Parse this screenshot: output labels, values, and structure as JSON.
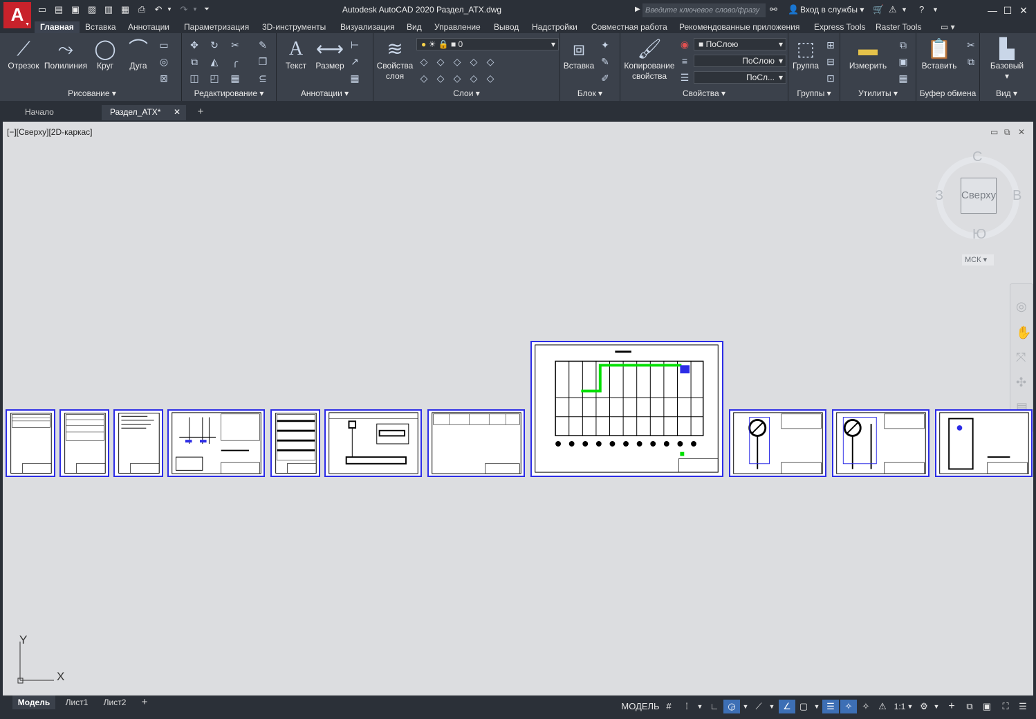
{
  "window": {
    "title": "Autodesk AutoCAD 2020    Раздел_ATX.dwg",
    "search_placeholder": "Введите ключевое слово/фразу",
    "signin": "Вход в службы"
  },
  "app_logo": "A",
  "ribbon_tabs": [
    "Главная",
    "Вставка",
    "Аннотации",
    "Параметризация",
    "3D-инструменты",
    "Визуализация",
    "Вид",
    "Управление",
    "Вывод",
    "Надстройки",
    "Совместная работа",
    "Рекомендованные приложения",
    "Express Tools",
    "Raster Tools"
  ],
  "draw": {
    "otrezok": "Отрезок",
    "polyline": "Полилиния",
    "circle": "Круг",
    "arc": "Дуга",
    "title": "Рисование"
  },
  "modify": {
    "title": "Редактирование"
  },
  "annot": {
    "text": "Текст",
    "dim": "Размер",
    "title": "Аннотации"
  },
  "layers": {
    "props_l1": "Свойства",
    "props_l2": "слоя",
    "current": "0",
    "title": "Слои"
  },
  "block": {
    "insert": "Вставка",
    "title": "Блок"
  },
  "props": {
    "copy_l1": "Копирование",
    "copy_l2": "свойства",
    "color": "ПоСлою",
    "linetype": "ПоСлою",
    "lineweight": "ПоСл...",
    "title": "Свойства"
  },
  "groups": {
    "group": "Группа",
    "title": "Группы"
  },
  "utils": {
    "measure": "Измерить",
    "title": "Утилиты"
  },
  "clip": {
    "paste": "Вставить",
    "title": "Буфер обмена"
  },
  "view": {
    "base": "Базовый",
    "title": "Вид"
  },
  "doc_tabs": {
    "start": "Начало",
    "current": "Раздел_ATX*",
    "close": "✕",
    "add": "+"
  },
  "viewport": {
    "label": "[−][Сверху][2D-каркас]"
  },
  "viewcube": {
    "north": "С",
    "south": "Ю",
    "west": "З",
    "east": "В",
    "face": "Сверху",
    "wcs": "МСК"
  },
  "ucs": {
    "x": "X",
    "y": "Y"
  },
  "layout_tabs": [
    "Модель",
    "Лист1",
    "Лист2"
  ],
  "layout_add": "+",
  "status": {
    "model": "МОДЕЛЬ",
    "scale": "1:1"
  },
  "colors": {
    "accent": "#3d6fb5",
    "sheet_border": "#2c2ce6",
    "highlight": "#00e000"
  }
}
